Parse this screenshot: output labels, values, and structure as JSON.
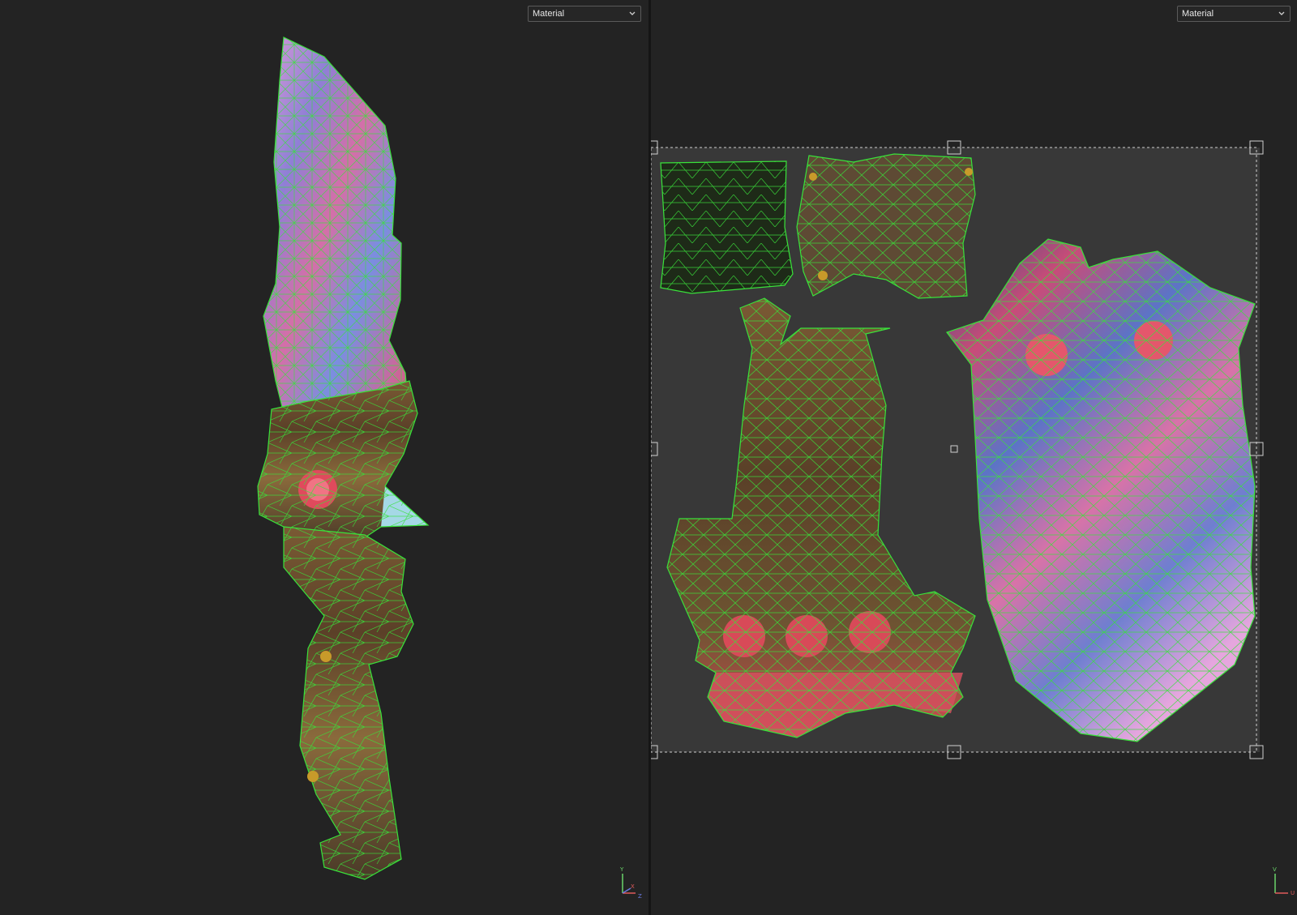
{
  "viewport_3d": {
    "shading_mode": "Material",
    "axis": {
      "up": "Y",
      "right": "X",
      "depth": "Z"
    }
  },
  "viewport_uv": {
    "shading_mode": "Material",
    "axis": {
      "up": "V",
      "right": "U"
    }
  },
  "colors": {
    "background": "#232323",
    "wireframe": "#39e23a",
    "uv_tile": "#383838",
    "selection_box": "#cfcfcf",
    "axis_x": "#e05a5a",
    "axis_y": "#6ad46a",
    "axis_z": "#6a7ae0"
  },
  "icons": [
    "chevron-down-icon",
    "axis-gizmo-icon",
    "transform-handle-icon"
  ]
}
